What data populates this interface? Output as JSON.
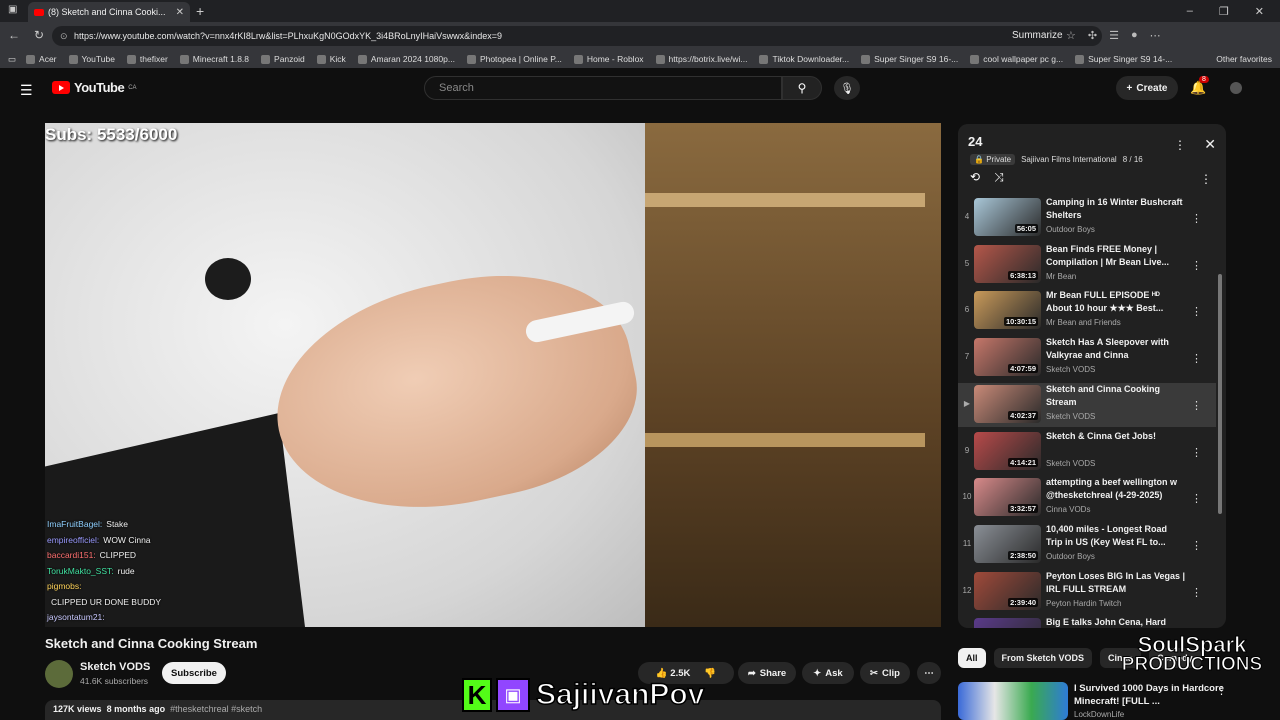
{
  "browser": {
    "tab_title": "(8) Sketch and Cinna Cooki...",
    "url": "https://www.youtube.com/watch?v=nnx4rKI8Lrw&list=PLhxuKgN0GOdxYK_3i4BRoLnyIHaiVswwx&index=9",
    "summarize": "Summarize",
    "bookmarks": [
      "Acer",
      "YouTube",
      "thefixer",
      "Minecraft 1.8.8",
      "Panzoid",
      "Kick",
      "Amaran 2024 1080p...",
      "Photopea | Online P...",
      "Home - Roblox",
      "https://botrix.live/wi...",
      "Tiktok Downloader...",
      "Super Singer S9 16-...",
      "cool wallpaper pc g...",
      "Super Singer S9 14-..."
    ],
    "other_favorites": "Other favorites"
  },
  "header": {
    "logo": "YouTube",
    "region": "CA",
    "search_placeholder": "Search",
    "create": "Create",
    "notifications": "8"
  },
  "video": {
    "subs_overlay": "Subs: 5533/6000",
    "chat": [
      {
        "user": "ImaFruitBagel:",
        "msg": "Stake",
        "cls": "n1"
      },
      {
        "user": "empireofficiel:",
        "msg": "WOW Cinna",
        "cls": "n2"
      },
      {
        "user": "baccardi151:",
        "msg": "CLIPPED",
        "cls": "n3"
      },
      {
        "user": "TorukMakto_SST:",
        "msg": "rude",
        "cls": "n4"
      },
      {
        "user": "pigmobs:",
        "msg": "",
        "cls": "n5"
      },
      {
        "user": "",
        "msg": "CLIPPED UR DONE BUDDY",
        "cls": "n6"
      },
      {
        "user": "jaysontatum21:",
        "msg": "",
        "cls": "n7"
      }
    ]
  },
  "meta": {
    "title": "Sketch and Cinna Cooking Stream",
    "channel": "Sketch VODS",
    "subscribers": "41.6K subscribers",
    "subscribe": "Subscribe",
    "likes": "2.5K",
    "share": "Share",
    "ask": "Ask",
    "clip": "Clip",
    "views": "127K views",
    "age": "8 months ago",
    "tags": "#thesketchreal #sketch"
  },
  "overlay": {
    "name": "SajiivanPov",
    "kick": "K",
    "soul_line1": "SoulSpark",
    "soul_line2": "PRODUCTIONS"
  },
  "playlist": {
    "title": "24",
    "privacy": "Private",
    "owner": "Sajiivan Films International",
    "position": "8 / 16",
    "items": [
      {
        "num": "4",
        "title": "Camping in 16 Winter Bushcraft Shelters",
        "channel": "Outdoor Boys",
        "duration": "56:05",
        "color": "#a9c7d8"
      },
      {
        "num": "5",
        "title": "Bean Finds FREE Money | Compilation | Mr Bean Live...",
        "channel": "Mr Bean",
        "duration": "6:38:13",
        "color": "#b5574a"
      },
      {
        "num": "6",
        "title": "Mr Bean FULL EPISODE ᴴᴰ About 10 hour ★★★ Best...",
        "channel": "Mr Bean and Friends",
        "duration": "10:30:15",
        "color": "#c99a5a"
      },
      {
        "num": "7",
        "title": "Sketch Has A Sleepover with Valkyrae and Cinna",
        "channel": "Sketch VODS",
        "duration": "4:07:59",
        "color": "#c6776a"
      },
      {
        "num": "▶",
        "title": "Sketch and Cinna Cooking Stream",
        "channel": "Sketch VODS",
        "duration": "4:02:37",
        "color": "#c98a78"
      },
      {
        "num": "9",
        "title": "Sketch & Cinna Get Jobs!",
        "channel": "Sketch VODS",
        "duration": "4:14:21",
        "color": "#b84a4a"
      },
      {
        "num": "10",
        "title": "attempting a beef wellington w @thesketchreal (4-29-2025)",
        "channel": "Cinna VODs",
        "duration": "3:32:57",
        "color": "#d88a8a"
      },
      {
        "num": "11",
        "title": "10,400 miles - Longest Road Trip in US (Key West FL to...",
        "channel": "Outdoor Boys",
        "duration": "2:38:50",
        "color": "#8a8f96"
      },
      {
        "num": "12",
        "title": "Peyton Loses BIG In Las Vegas | IRL FULL STREAM",
        "channel": "Peyton Hardin Twitch",
        "duration": "2:39:40",
        "color": "#a04a3a"
      },
      {
        "num": "13",
        "title": "Big E talks John Cena, Hard",
        "channel": "",
        "duration": "",
        "color": "#5a3a8a"
      }
    ]
  },
  "chips": [
    "All",
    "From Sketch VODS",
    "Cinna",
    "Comedy"
  ],
  "recommended": {
    "title": "I Survived 1000 Days in Hardcore Minecraft! [FULL ...",
    "channel": "LockDownLife"
  },
  "colors": {
    "accent": "#ff0000",
    "bg": "#0f0f0f",
    "panel": "#212121"
  }
}
